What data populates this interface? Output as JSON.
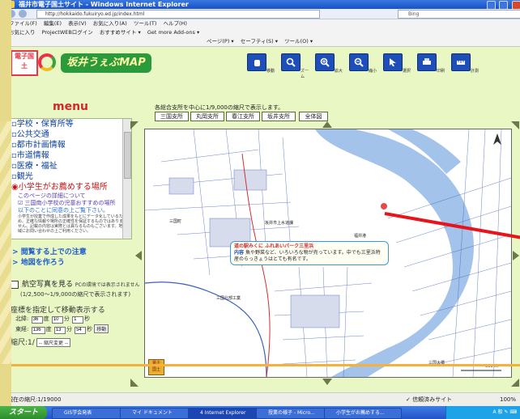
{
  "window": {
    "title": "福井市電子国土サイト - Windows Internet Explorer",
    "address": "http://hokkaido.fukuiryo.ed.jp/index.html",
    "search_placeholder": "Bing"
  },
  "ie_menu": [
    "ファイル(F)",
    "編集(E)",
    "表示(V)",
    "お気に入り(A)",
    "ツール(T)",
    "ヘルプ(H)"
  ],
  "favorites_bar": [
    "お気に入り",
    "ProjectWEBログイン",
    "おすすめサイト ▾",
    "Get more Add-ons ▾"
  ],
  "command_bar": [
    "ページ(P) ▾",
    "セーフティ(S) ▾",
    "ツール(O) ▾"
  ],
  "logo": {
    "badge": "電子国土",
    "title": "坂井うぇぶMAP"
  },
  "toolbar": [
    {
      "name": "move",
      "label": "移動"
    },
    {
      "name": "zoom",
      "label": "ズーム"
    },
    {
      "name": "zoom-in",
      "label": "拡大"
    },
    {
      "name": "zoom-out",
      "label": "縮小"
    },
    {
      "name": "select",
      "label": "選択"
    },
    {
      "name": "print",
      "label": "印刷"
    },
    {
      "name": "measure",
      "label": "計測"
    }
  ],
  "menu": {
    "title": "menu",
    "items": [
      {
        "label": "学校・保育所等"
      },
      {
        "label": "公共交通"
      },
      {
        "label": "都市計画情報"
      },
      {
        "label": "市道情報"
      },
      {
        "label": "医療・福祉"
      },
      {
        "label": "観光"
      },
      {
        "label": "小学生がお薦めする場所"
      }
    ],
    "sub1": "このページの詳細について",
    "sub2": "三国南小学校の児童おすすめの場所",
    "sub3": "以下のことに同意の上ご覧下さい。",
    "small": "小学生が授業で作成した成果をもとにデータ化しているため、正確な情報や場所の正確性を保証するものではありません。記載の内容は実際とは異なるものもございます。地域にお問い合わせの上ご利用ください。"
  },
  "links": {
    "notice": "閲覧する上での注意",
    "create_map": "地図を作ろう"
  },
  "aerial": {
    "label": "航空写真を見る",
    "note": "PCの環境では表示されません",
    "sub": "(1/2,500～1/9,000の縮尺で表示されます)"
  },
  "coords": {
    "title": "座標を指定して移動表示する",
    "lat_label": "北緯:",
    "lat": [
      "36",
      "10",
      "1"
    ],
    "lat_units": [
      "度",
      "分",
      "秒"
    ],
    "lon_label": "東経:",
    "lon": [
      "136",
      "13",
      "54"
    ],
    "lon_units": [
      "度",
      "分",
      "秒"
    ],
    "move_button": "移動"
  },
  "scale": {
    "label": "縮尺:1/",
    "select": "-- 縮尺変更 --"
  },
  "map_header": {
    "info": "各総合支所を中心に1/9,000の縮尺で表示します。",
    "buttons": [
      "三国支所",
      "丸岡支所",
      "春江支所",
      "坂井支所",
      "全体図"
    ]
  },
  "map": {
    "labels": [
      "三国町",
      "福井港",
      "三国大橋",
      "坂井市上水道課",
      "三国北部工業",
      "500 m"
    ],
    "popup_title": "道の駅みくに ふれあいパーク三里浜",
    "popup_label": "内容",
    "popup_text": "魚や野菜など、いろいろな物が売っています。中でも三里浜特産のらっきょうはとても有名です。"
  },
  "status": {
    "left": "現在の縮尺:1/19000",
    "zone": "信頼済みサイト",
    "zoom": "100%"
  },
  "taskbar": {
    "start": "スタート",
    "tasks": [
      "GIS学会発表",
      "マイ ドキュメント",
      "4 Internet Explorer",
      "授業の様子 - Micro...",
      "小学生がお薦めする..."
    ],
    "tray": "A 般 ✎ ⌨"
  },
  "colors": {
    "accent_red": "#d2282a",
    "link_blue": "#1f5ec7",
    "page_bg": "#e9f7c4",
    "orange_bar": "#f4b23a"
  }
}
